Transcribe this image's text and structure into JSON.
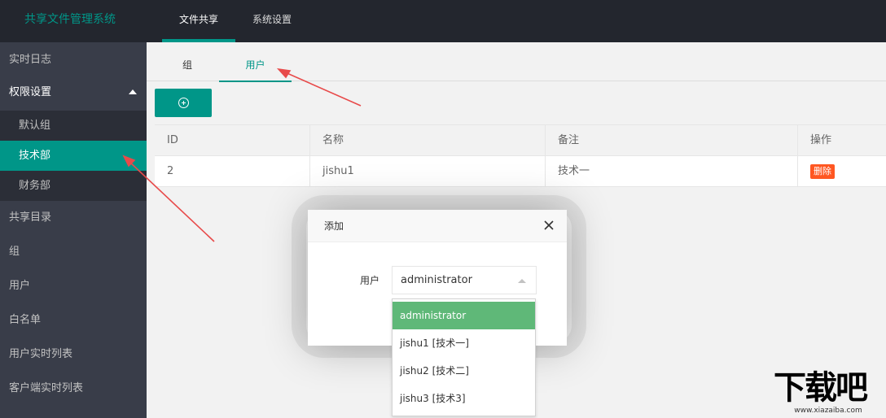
{
  "topbar": {
    "app_title": "共享文件管理系统",
    "tabs": [
      {
        "label": "文件共享",
        "active": true
      },
      {
        "label": "系统设置",
        "active": false
      }
    ]
  },
  "sidebar": {
    "items": [
      {
        "label": "实时日志"
      },
      {
        "label": "权限设置",
        "expanded": true
      },
      {
        "label": "共享目录"
      },
      {
        "label": "组"
      },
      {
        "label": "用户"
      },
      {
        "label": "白名单"
      },
      {
        "label": "用户实时列表"
      },
      {
        "label": "客户端实时列表"
      }
    ],
    "sub_items": [
      {
        "label": "默认组",
        "active": false
      },
      {
        "label": "技术部",
        "active": true
      },
      {
        "label": "财务部",
        "active": false
      }
    ]
  },
  "main": {
    "tabs": [
      {
        "label": "组",
        "active": false
      },
      {
        "label": "用户",
        "active": true
      }
    ],
    "add_button_icon": "plus-circle-icon",
    "table": {
      "headers": [
        "ID",
        "名称",
        "备注",
        "操作"
      ],
      "rows": [
        {
          "id": "2",
          "name": "jishu1",
          "note": "技术一",
          "action": "删除"
        }
      ]
    }
  },
  "dialog": {
    "title": "添加",
    "close_icon": "close-icon",
    "field_label": "用户",
    "selected_value": "administrator",
    "options": [
      "administrator",
      "jishu1 [技术一]",
      "jishu2 [技术二]",
      "jishu3 [技术3]"
    ]
  },
  "watermark": {
    "logo": "下载吧",
    "url": "www.xiazaiba.com"
  },
  "colors": {
    "accent": "#009688",
    "topbar": "#23262e",
    "sidebar": "#393d49",
    "danger": "#ff5722",
    "option_selected": "#5fb878",
    "annotation": "#e84a4a"
  }
}
